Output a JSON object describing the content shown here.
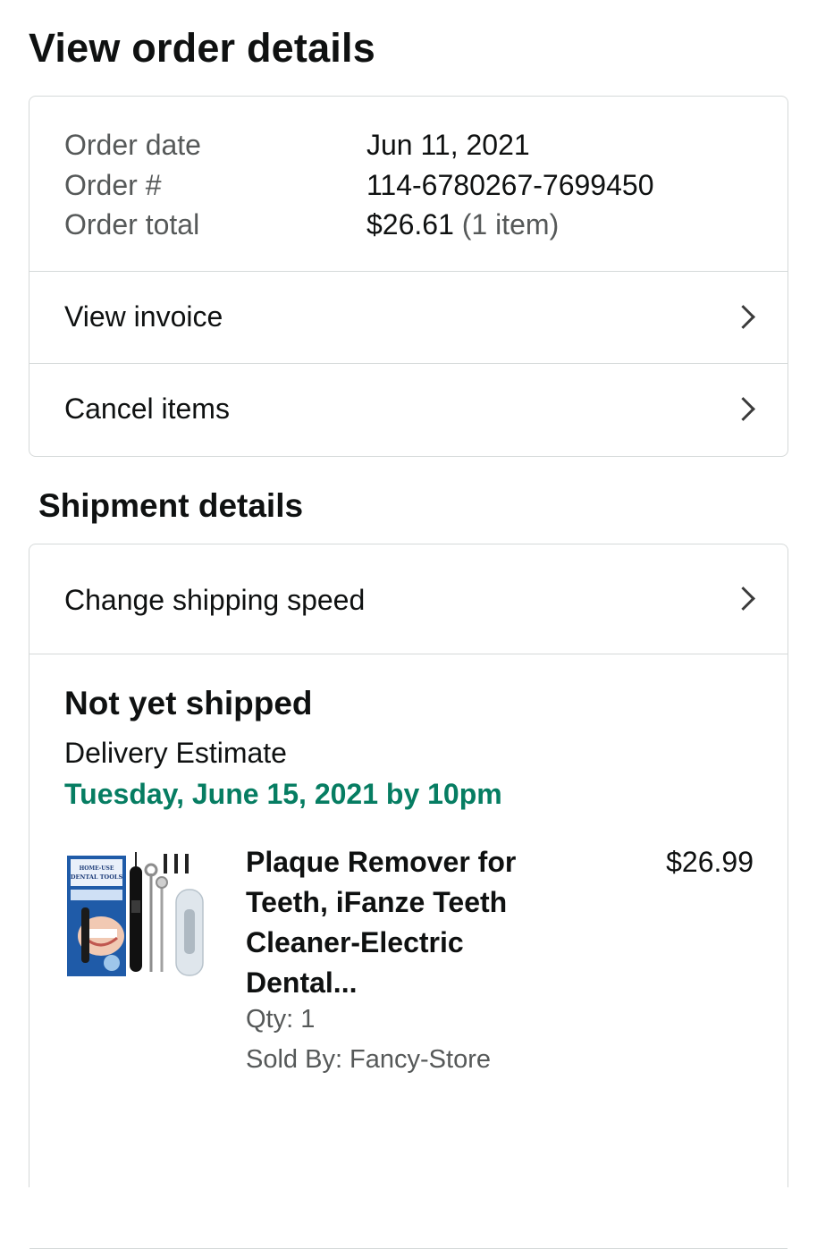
{
  "page": {
    "title": "View order details"
  },
  "order": {
    "rows": [
      {
        "label": "Order date",
        "value": "Jun 11, 2021"
      },
      {
        "label": "Order #",
        "value": "114-6780267-7699450"
      },
      {
        "label": "Order total",
        "value": "$26.61",
        "extra": "(1 item)"
      }
    ],
    "links": {
      "view_invoice": "View invoice",
      "cancel_items": "Cancel items"
    }
  },
  "shipment": {
    "section_title": "Shipment details",
    "change_speed": "Change shipping speed",
    "status": "Not yet shipped",
    "estimate_label": "Delivery Estimate",
    "estimate_date": "Tuesday, June 15, 2021 by 10pm",
    "item": {
      "title": "Plaque Remover for Teeth, iFanze Teeth Cleaner-Electric Dental...",
      "price": "$26.99",
      "qty": "Qty: 1",
      "seller": "Sold By: Fancy-Store",
      "image_icon": "dental-tools-product-image",
      "box_text_1": "HOME-USE",
      "box_text_2": "DENTAL TOOLS"
    }
  },
  "colors": {
    "text": "#0f1111",
    "muted": "#565959",
    "green": "#067d62",
    "border": "#d5d9d9"
  }
}
